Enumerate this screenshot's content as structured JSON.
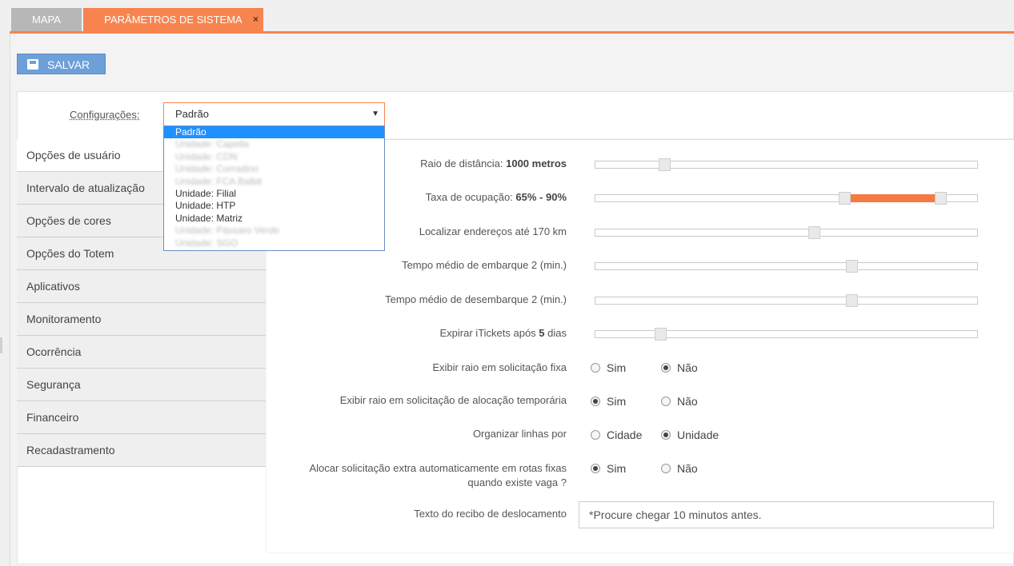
{
  "tabs": [
    {
      "label": "MAPA"
    },
    {
      "label": "PARÂMETROS DE SISTEMA",
      "close": "×"
    }
  ],
  "toolbar": {
    "save_label": "SALVAR"
  },
  "config": {
    "label": "Configurações:",
    "selected": "Padrão",
    "arrow": "▼",
    "options": [
      "Padrão",
      "Unidade: Capella",
      "Unidade: CDN",
      "Unidade: Corradino",
      "Unidade: FCA Balbit",
      "Unidade: Filial",
      "Unidade: HTP",
      "Unidade: Matriz",
      "Unidade: Pássaro Verde",
      "Unidade: SGO"
    ]
  },
  "sidebar": {
    "items": [
      {
        "label": "Opções de usuário"
      },
      {
        "label": "Intervalo de atualização"
      },
      {
        "label": "Opções de cores"
      },
      {
        "label": "Opções do Totem"
      },
      {
        "label": "Aplicativos"
      },
      {
        "label": "Monitoramento"
      },
      {
        "label": "Ocorrência"
      },
      {
        "label": "Segurança"
      },
      {
        "label": "Financeiro"
      },
      {
        "label": "Recadastramento"
      }
    ]
  },
  "settings": {
    "raio": {
      "prefix": "Raio de distância: ",
      "value": "1000 metros",
      "slider": 0.18
    },
    "taxa": {
      "prefix": "Taxa de ocupação: ",
      "value": "65% - 90%",
      "slider_min": 0.65,
      "slider_max": 0.9
    },
    "localizar": {
      "label": "Localizar endereços até 170 km",
      "slider": 0.57
    },
    "embarque": {
      "label": "Tempo médio de embarque 2 (min.)",
      "slider": 0.67
    },
    "desembarque": {
      "label": "Tempo médio de desembarque 2 (min.)",
      "slider": 0.67
    },
    "itickets": {
      "prefix": "Expirar iTickets após ",
      "value": "5",
      "suffix": " dias",
      "slider": 0.17
    },
    "exibir_fixa": {
      "label": "Exibir raio em solicitação fixa",
      "opt1": "Sim",
      "opt2": "Não",
      "selected": "Não"
    },
    "exibir_temp": {
      "label": "Exibir raio em solicitação de alocação temporária",
      "opt1": "Sim",
      "opt2": "Não",
      "selected": "Sim"
    },
    "organizar": {
      "label": "Organizar linhas por",
      "opt1": "Cidade",
      "opt2": "Unidade",
      "selected": "Unidade"
    },
    "alocar": {
      "label_line1": "Alocar solicitação extra automaticamente em rotas fixas",
      "label_line2": "quando existe vaga ?",
      "opt1": "Sim",
      "opt2": "Não",
      "selected": "Sim"
    },
    "recibo": {
      "label": "Texto do recibo de deslocamento",
      "value": "*Procure chegar 10 minutos antes."
    }
  },
  "colors": {
    "accent": "#f7844f",
    "button": "#6d9fd9",
    "slider_range": "#f47a44"
  }
}
